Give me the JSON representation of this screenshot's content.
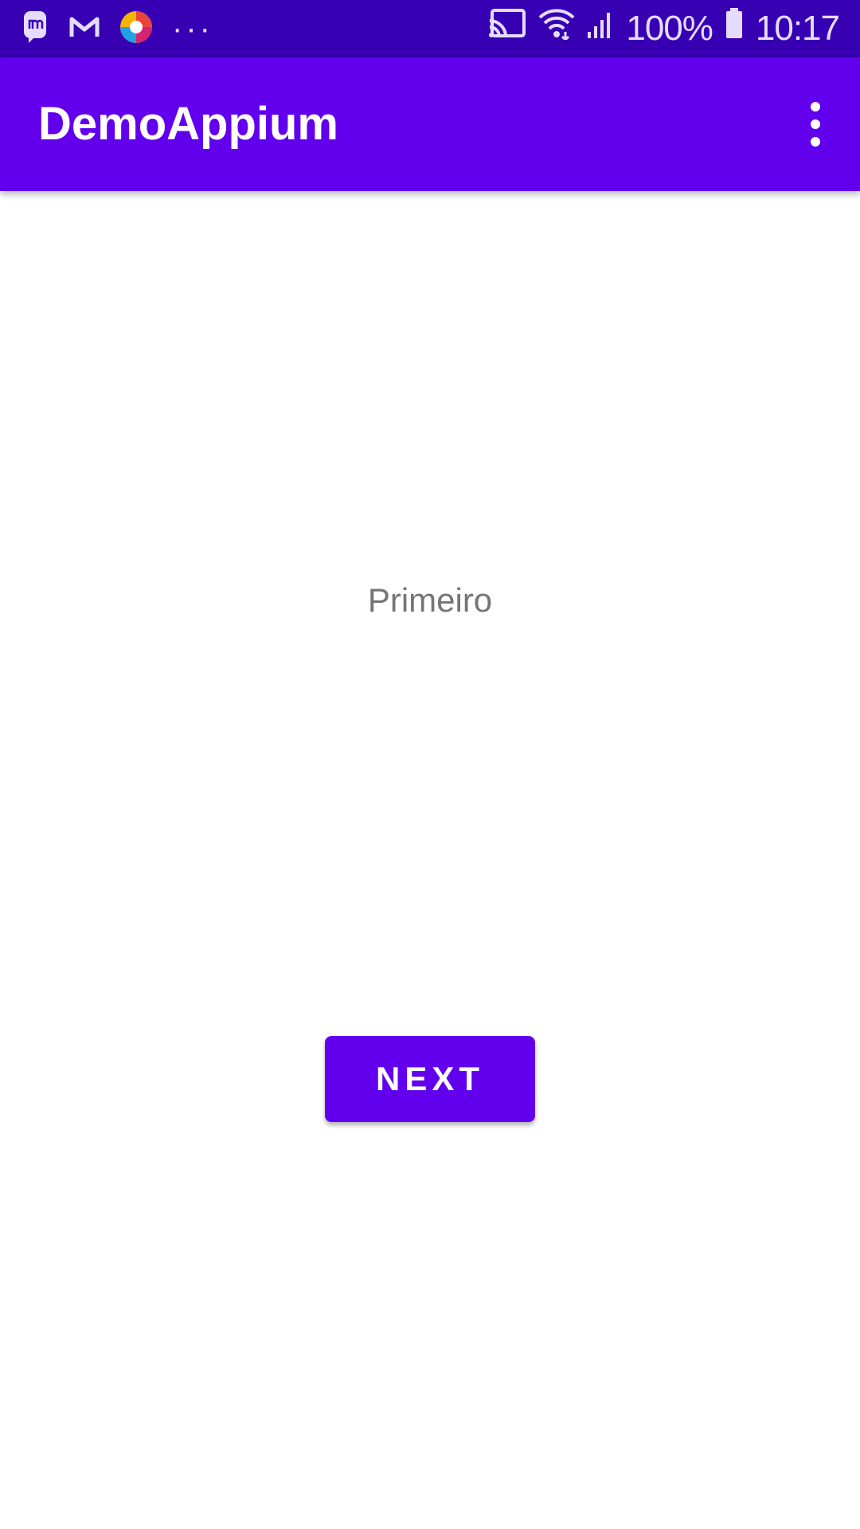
{
  "status_bar": {
    "notification_icons": [
      "messenger-icon",
      "gmail-icon",
      "browser-icon",
      "more-notifications-icon"
    ],
    "more_glyph": "···",
    "cast_icon": "cast-icon",
    "wifi_icon": "wifi-icon",
    "signal_icon": "signal-icon",
    "battery_percent": "100%",
    "battery_icon": "battery-icon",
    "time": "10:17",
    "background_color": "#3700B3"
  },
  "app_bar": {
    "title": "DemoAppium",
    "overflow_icon": "more-vert-icon",
    "background_color": "#6200EE"
  },
  "main": {
    "label": "Primeiro",
    "next_button_label": "NEXT"
  }
}
